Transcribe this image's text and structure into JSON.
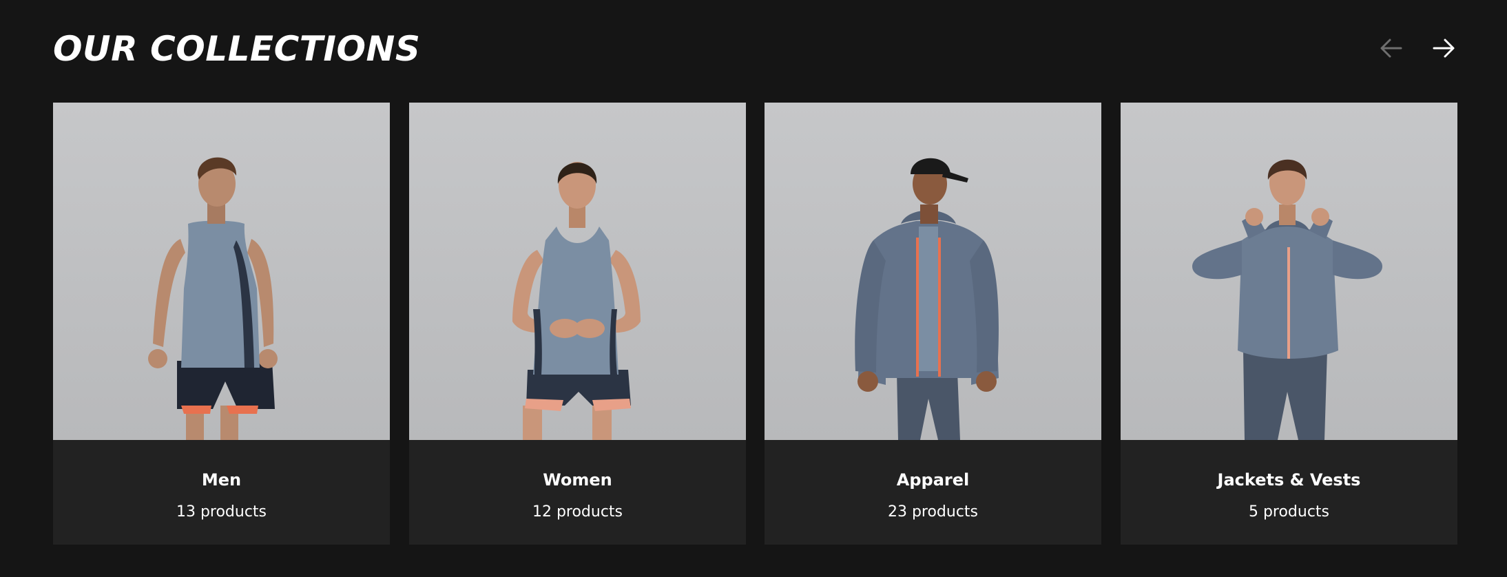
{
  "section": {
    "title": "OUR COLLECTIONS",
    "prev_icon": "arrow-left-icon",
    "next_icon": "arrow-right-icon"
  },
  "colors": {
    "background": "#151515",
    "card_info_background": "#222222",
    "photo_background": "#c2c3c5",
    "text": "#ffffff",
    "arrow_disabled": "#6f6f6f",
    "apparel_gray": "#6b7a8c",
    "accent_orange": "#e8714f"
  },
  "collections": [
    {
      "name": "Men",
      "count": "13 products",
      "image": "man-in-gray-tank-top-and-shorts"
    },
    {
      "name": "Women",
      "count": "12 products",
      "image": "woman-in-gray-tank-top-and-shorts"
    },
    {
      "name": "Apparel",
      "count": "23 products",
      "image": "man-in-cap-and-gray-jacket"
    },
    {
      "name": "Jackets & Vests",
      "count": "5 products",
      "image": "woman-in-gray-zip-jacket"
    }
  ]
}
